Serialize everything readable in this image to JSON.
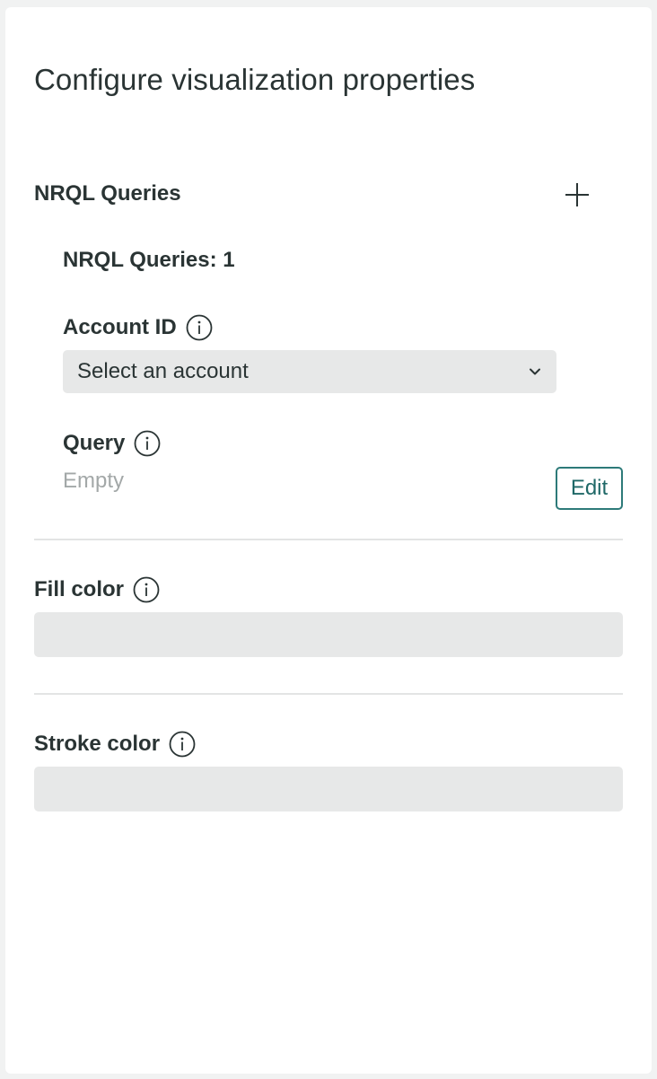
{
  "title": "Configure visualization properties",
  "nrql_section": {
    "heading": "NRQL Queries",
    "add_icon": "plus-icon",
    "query_item": {
      "heading": "NRQL Queries: 1",
      "account_label": "Account ID",
      "account_select_value": "Select an account",
      "query_label": "Query",
      "query_value": "Empty",
      "edit_label": "Edit"
    }
  },
  "fill_color": {
    "label": "Fill color",
    "value": ""
  },
  "stroke_color": {
    "label": "Stroke color",
    "value": ""
  },
  "colors": {
    "accent": "#2d7a79",
    "text": "#2a3434",
    "muted": "#a3a8a8",
    "field_bg": "#e7e8e8"
  }
}
